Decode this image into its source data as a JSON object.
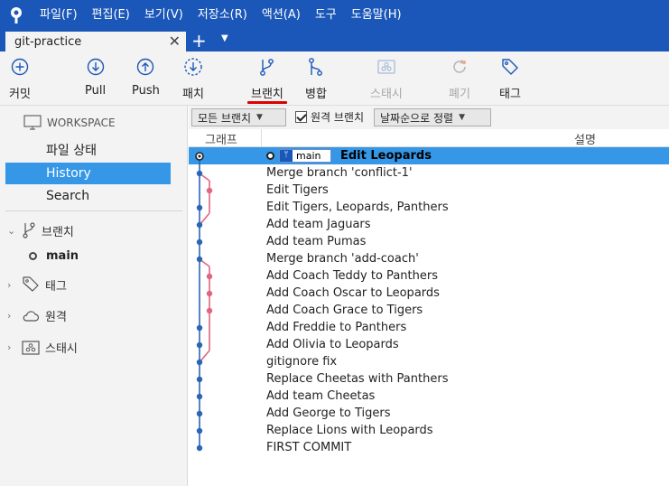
{
  "menu": [
    "파일(F)",
    "편집(E)",
    "보기(V)",
    "저장소(R)",
    "액션(A)",
    "도구",
    "도움말(H)"
  ],
  "tab": {
    "title": "git-practice",
    "close": "✕",
    "add": "+",
    "dropdown": "▼"
  },
  "toolbar": {
    "commit": "커밋",
    "pull": "Pull",
    "push": "Push",
    "patch": "패치",
    "branch": "브랜치",
    "merge": "병합",
    "stash": "스태시",
    "discard": "폐기",
    "tag": "태그"
  },
  "sidebar": {
    "workspace": "WORKSPACE",
    "file_status": "파일 상태",
    "history": "History",
    "search": "Search",
    "branches": "브랜치",
    "branch_main": "main",
    "tags": "태그",
    "remotes": "원격",
    "stashes": "스태시"
  },
  "filter": {
    "branch_filter": "모든 브랜치",
    "remote_branches": "원격 브랜치",
    "sort": "날짜순으로 정렬"
  },
  "columns": {
    "graph": "그래프",
    "description": "설명"
  },
  "commits": [
    "Edit Leopards",
    "Merge branch 'conflict-1'",
    "Edit Tigers",
    "Edit Tigers, Leopards, Panthers",
    "Add team Jaguars",
    "Add team Pumas",
    "Merge branch 'add-coach'",
    "Add Coach Teddy to Panthers",
    "Add Coach Oscar to Leopards",
    "Add Coach Grace to Tigers",
    "Add Freddie to Panthers",
    "Add Olivia to Leopards",
    "gitignore fix",
    "Replace Cheetas with Panthers",
    "Add team Cheetas",
    "Add George to Tigers",
    "Replace Lions with Leopards",
    "FIRST COMMIT"
  ],
  "head_branch_badge": "main",
  "colors": {
    "menubar": "#1b57b8",
    "selection": "#3597e6",
    "graph_main": "#2b65b5",
    "graph_branch": "#e06680",
    "active_underline": "#dd0000"
  }
}
